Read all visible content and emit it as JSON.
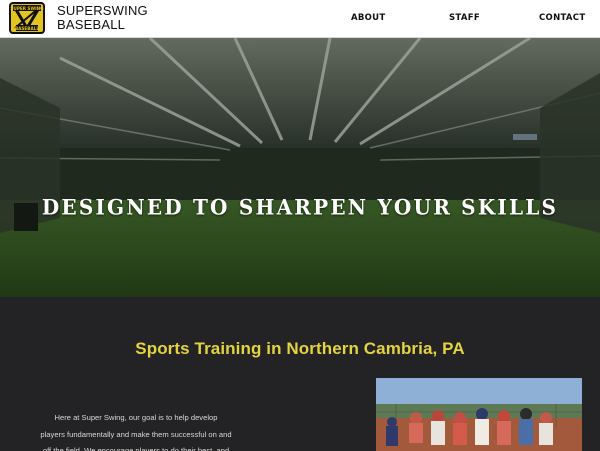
{
  "header": {
    "brand_line1": "SUPERSWING",
    "brand_line2": "BASEBALL",
    "logo_text": "SUPER SWING",
    "logo_subtext": "BASEBALL",
    "nav": [
      {
        "label": "ABOUT"
      },
      {
        "label": "STAFF"
      },
      {
        "label": "CONTACT"
      }
    ]
  },
  "hero": {
    "title": "DESIGNED TO SHARPEN YOUR SKILLS"
  },
  "intro": {
    "title": "Sports Training in Northern Cambria, PA",
    "lines": [
      "Here at Super Swing, our goal is to help develop",
      "players fundamentally and make them successful on and",
      "off the field. We encourage players to do their best, and"
    ]
  },
  "colors": {
    "accent_yellow": "#e2d33f",
    "dark_bg": "#232325",
    "header_bg": "#ffffff"
  }
}
